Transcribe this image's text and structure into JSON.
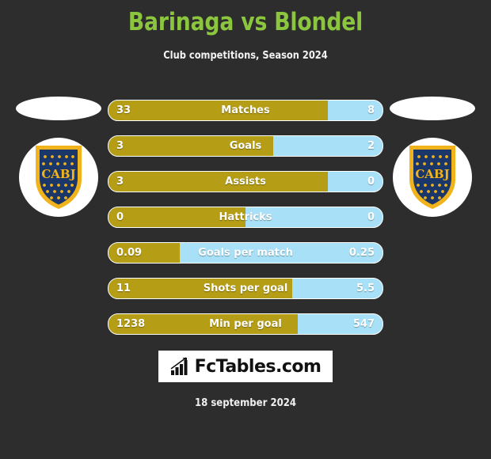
{
  "header": {
    "title": "Barinaga vs Blondel",
    "subtitle": "Club competitions, Season 2024",
    "title_color": "#8cc63f"
  },
  "teams": {
    "home": {
      "badge_text": "CABJ",
      "shield_color": "#1b3668",
      "trim_color": "#f0b31c"
    },
    "away": {
      "badge_text": "CABJ",
      "shield_color": "#1b3668",
      "trim_color": "#f0b31c"
    }
  },
  "colors": {
    "background": "#2d2d2d",
    "home_bar": "#b59d15",
    "away_bar": "#a8e1f7"
  },
  "stats": [
    {
      "label": "Matches",
      "home": "33",
      "away": "8",
      "home_pct": 80
    },
    {
      "label": "Goals",
      "home": "3",
      "away": "2",
      "home_pct": 60
    },
    {
      "label": "Assists",
      "home": "3",
      "away": "0",
      "home_pct": 80
    },
    {
      "label": "Hattricks",
      "home": "0",
      "away": "0",
      "home_pct": 50
    },
    {
      "label": "Goals per match",
      "home": "0.09",
      "away": "0.25",
      "home_pct": 26
    },
    {
      "label": "Shots per goal",
      "home": "11",
      "away": "5.5",
      "home_pct": 67
    },
    {
      "label": "Min per goal",
      "home": "1238",
      "away": "547",
      "home_pct": 69
    }
  ],
  "footer": {
    "logo_text": "FcTables.com",
    "logo_icon": "bar-chart-trend-icon",
    "date": "18 september 2024"
  }
}
